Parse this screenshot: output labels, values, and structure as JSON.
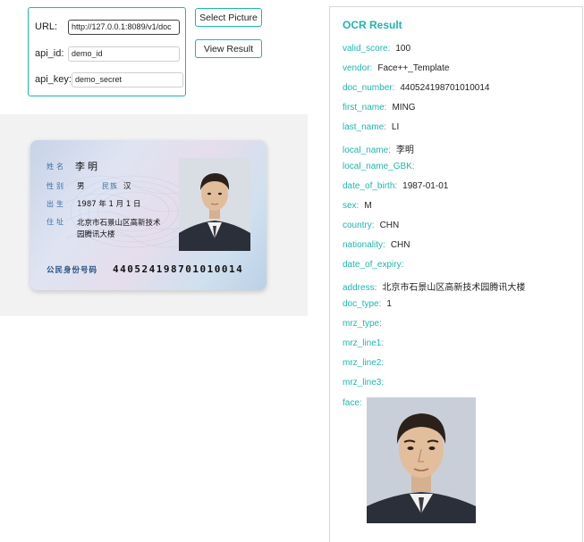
{
  "config": {
    "url_label": "URL:",
    "url_value": "http://127.0.0.1:8089/v1/doc",
    "api_id_label": "api_id:",
    "api_id_value": "demo_id",
    "api_key_label": "api_key:",
    "api_key_value": "demo_secret"
  },
  "buttons": {
    "select_picture": "Select Picture",
    "view_result": "View Result"
  },
  "id_card": {
    "name_label": "姓名",
    "name_value": "李明",
    "sex_label": "性别",
    "sex_value": "男",
    "ethnic_label": "民族",
    "ethnic_value": "汉",
    "birth_label": "出生",
    "birth_value": "1987 年 1 月 1 日",
    "address_label": "住址",
    "address_line1": "北京市石景山区高新技术",
    "address_line2": "园腾讯大楼",
    "number_label": "公民身份号码",
    "number_value": "440524198701010014"
  },
  "result": {
    "title": "OCR Result",
    "fields": [
      {
        "key": "valid_score:",
        "value": "100"
      },
      {
        "key": "vendor:",
        "value": "Face++_Template"
      },
      {
        "key": "doc_number:",
        "value": "440524198701010014"
      },
      {
        "key": "first_name:",
        "value": "MING"
      },
      {
        "key": "last_name:",
        "value": "LI"
      },
      {
        "key": "local_name:",
        "value": "李明"
      },
      {
        "key": "local_name_GBK:",
        "value": ""
      },
      {
        "key": "date_of_birth:",
        "value": "1987-01-01"
      },
      {
        "key": "sex:",
        "value": "M"
      },
      {
        "key": "country:",
        "value": "CHN"
      },
      {
        "key": "nationality:",
        "value": "CHN"
      },
      {
        "key": "date_of_expiry:",
        "value": ""
      },
      {
        "key": "address:",
        "value": "北京市石景山区高新技术园腾讯大楼"
      },
      {
        "key": "doc_type:",
        "value": "1"
      },
      {
        "key": "mrz_type:",
        "value": ""
      },
      {
        "key": "mrz_line1:",
        "value": ""
      },
      {
        "key": "mrz_line2:",
        "value": ""
      },
      {
        "key": "mrz_line3:",
        "value": ""
      },
      {
        "key": "face:",
        "value": ""
      }
    ]
  },
  "colors": {
    "accent": "#1fb5ad",
    "card_label": "#3a6fa0"
  }
}
